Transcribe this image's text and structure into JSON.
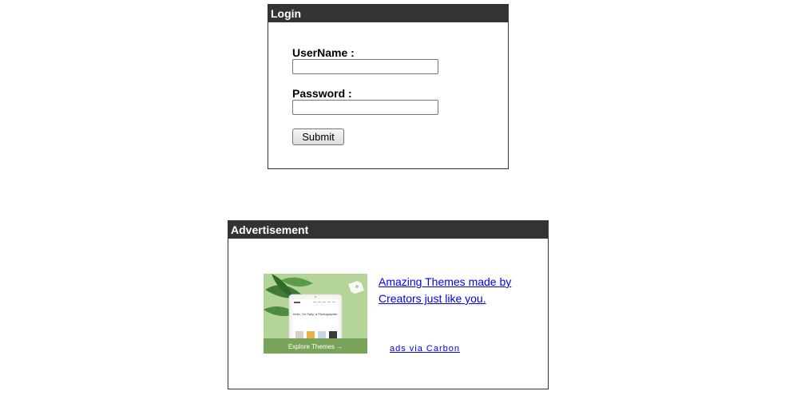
{
  "login": {
    "title": "Login",
    "username_label": "UserName :",
    "username_value": "",
    "password_label": "Password :",
    "password_value": "",
    "submit_label": "Submit"
  },
  "advertisement": {
    "title": "Advertisement",
    "ad_text": "Amazing Themes made by Creators just like you.",
    "ad_via": "ads via Carbon",
    "image": {
      "greeting": "Hello, I'm Sally, a Photographer.",
      "cta": "Explore Themes →",
      "background_color": "#b5d49a",
      "cta_bar_color": "#7aa35a"
    }
  },
  "colors": {
    "header_bg": "#333333",
    "link": "#0000ee"
  }
}
